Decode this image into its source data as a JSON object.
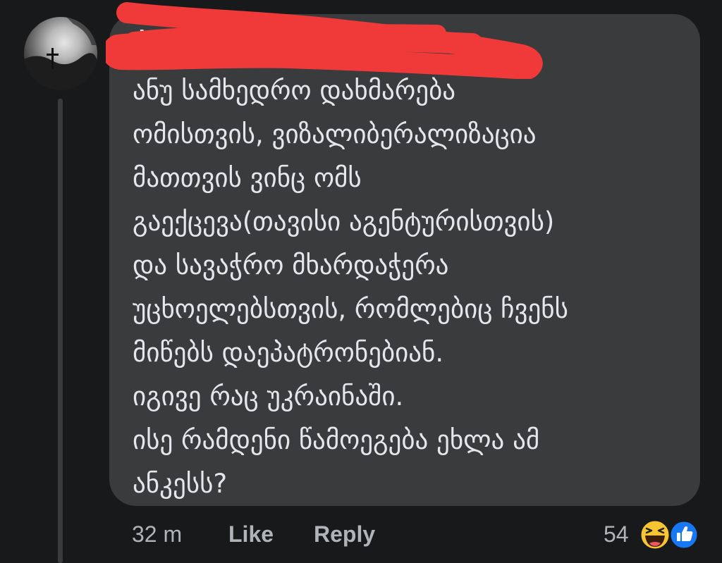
{
  "comment": {
    "author": "ბ",
    "lines": [
      "ანუ სამხედრო დახმარება",
      "ომისთვის,  ვიზალიბერალიზაცია",
      "მათთვის ვინც ომს",
      "გაექცევა(თავისი აგენტურისთვის)",
      "და სავაჭრო მხარდაჭერა",
      "უცხოელებსთვის, რომლებიც ჩვენს",
      "მიწებს დაეპატრონებიან.",
      "იგივე რაც უკრაინაში.",
      "ისე რამდენი წამოეგება ეხლა ამ",
      "ანკესს?"
    ]
  },
  "actions": {
    "time": "32 m",
    "like_label": "Like",
    "reply_label": "Reply",
    "reaction_count": "54"
  },
  "reactions": [
    {
      "icon": "haha-reaction-icon",
      "color": "#f7c531"
    },
    {
      "icon": "like-reaction-icon",
      "color": "#1877f2"
    }
  ],
  "colors": {
    "background": "#18191a",
    "bubble": "#3a3b3c",
    "text": "#e4e6eb",
    "secondary_text": "#b0b3b8",
    "redaction": "#f03a3a"
  }
}
